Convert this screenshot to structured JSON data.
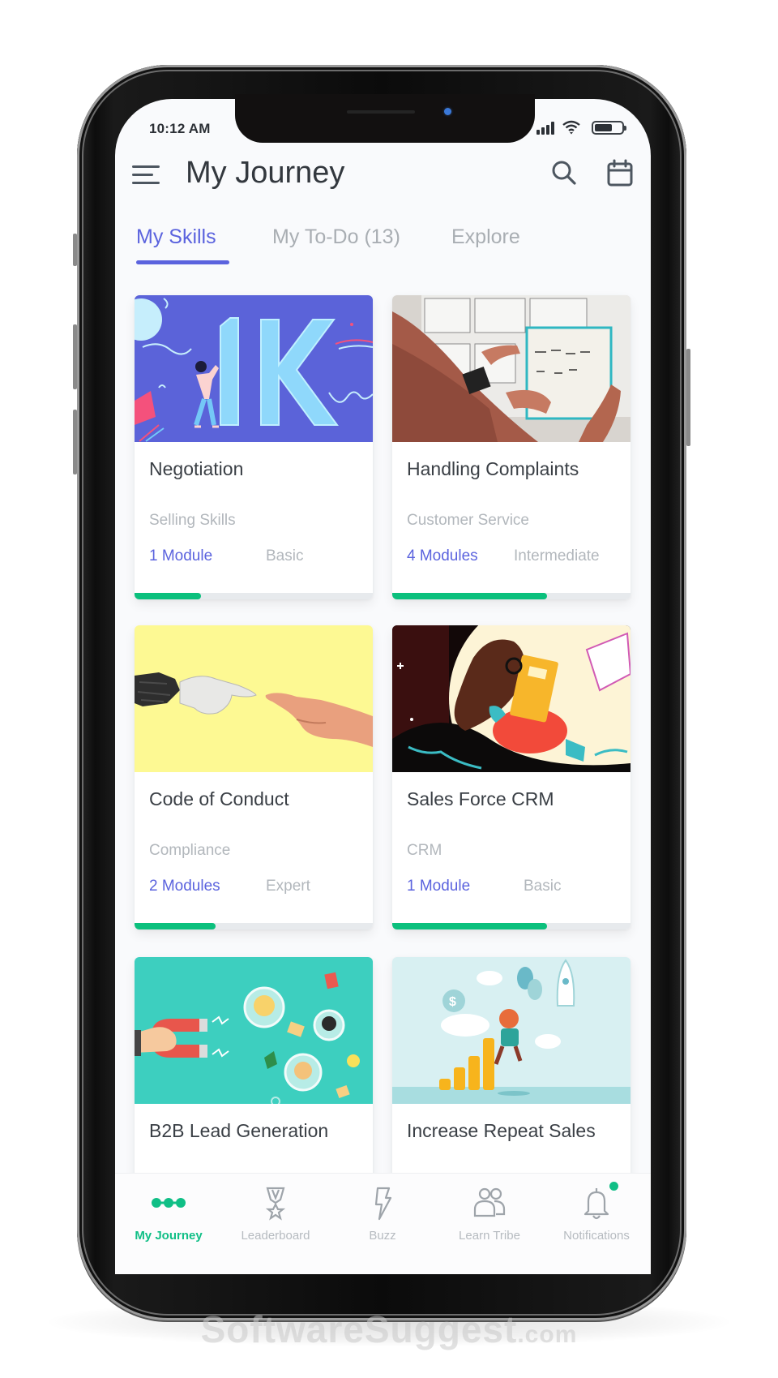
{
  "status_bar": {
    "time": "10:12 AM",
    "icons": [
      "cellular-signal-icon",
      "wifi-icon",
      "battery-icon"
    ],
    "battery_level": 0.65
  },
  "header": {
    "title": "My Journey",
    "menu_icon": "hamburger-menu-icon",
    "actions": [
      "search-icon",
      "calendar-icon"
    ]
  },
  "tabs": [
    {
      "label": "My Skills",
      "active": true
    },
    {
      "label": "My To-Do (13)",
      "active": false
    },
    {
      "label": "Explore",
      "active": false
    }
  ],
  "colors": {
    "accent": "#5b63de",
    "progress": "#0bc07d",
    "nav_active": "#10bf86",
    "muted_text": "#b2b7bc",
    "title_text": "#3a3f45"
  },
  "cards": [
    {
      "title": "Negotiation",
      "category": "Selling Skills",
      "modules": "1 Module",
      "level": "Basic",
      "progress": 0.28,
      "image": "1k-illustration"
    },
    {
      "title": "Handling Complaints",
      "category": "Customer Service",
      "modules": "4 Modules",
      "level": "Intermediate",
      "progress": 0.65,
      "image": "storyboard-photo"
    },
    {
      "title": "Code of Conduct",
      "category": "Compliance",
      "modules": "2 Modules",
      "level": "Expert",
      "progress": 0.34,
      "image": "robot-human-hands"
    },
    {
      "title": "Sales Force CRM",
      "category": "CRM",
      "modules": "1 Module",
      "level": "Basic",
      "progress": 0.65,
      "image": "girl-reading-illustration"
    },
    {
      "title": "B2B Lead Generation",
      "image": "magnet-leads-illustration"
    },
    {
      "title": "Increase Repeat Sales",
      "image": "coins-growth-illustration"
    }
  ],
  "bottom_nav": [
    {
      "label": "My Journey",
      "icon": "journey-dots-icon",
      "active": true
    },
    {
      "label": "Leaderboard",
      "icon": "medal-icon",
      "active": false
    },
    {
      "label": "Buzz",
      "icon": "lightning-icon",
      "active": false
    },
    {
      "label": "Learn Tribe",
      "icon": "people-icon",
      "active": false
    },
    {
      "label": "Notifications",
      "icon": "bell-icon",
      "active": false,
      "has_badge": true
    }
  ],
  "watermark": {
    "main": "SoftwareSuggest",
    "suffix": ".com"
  }
}
